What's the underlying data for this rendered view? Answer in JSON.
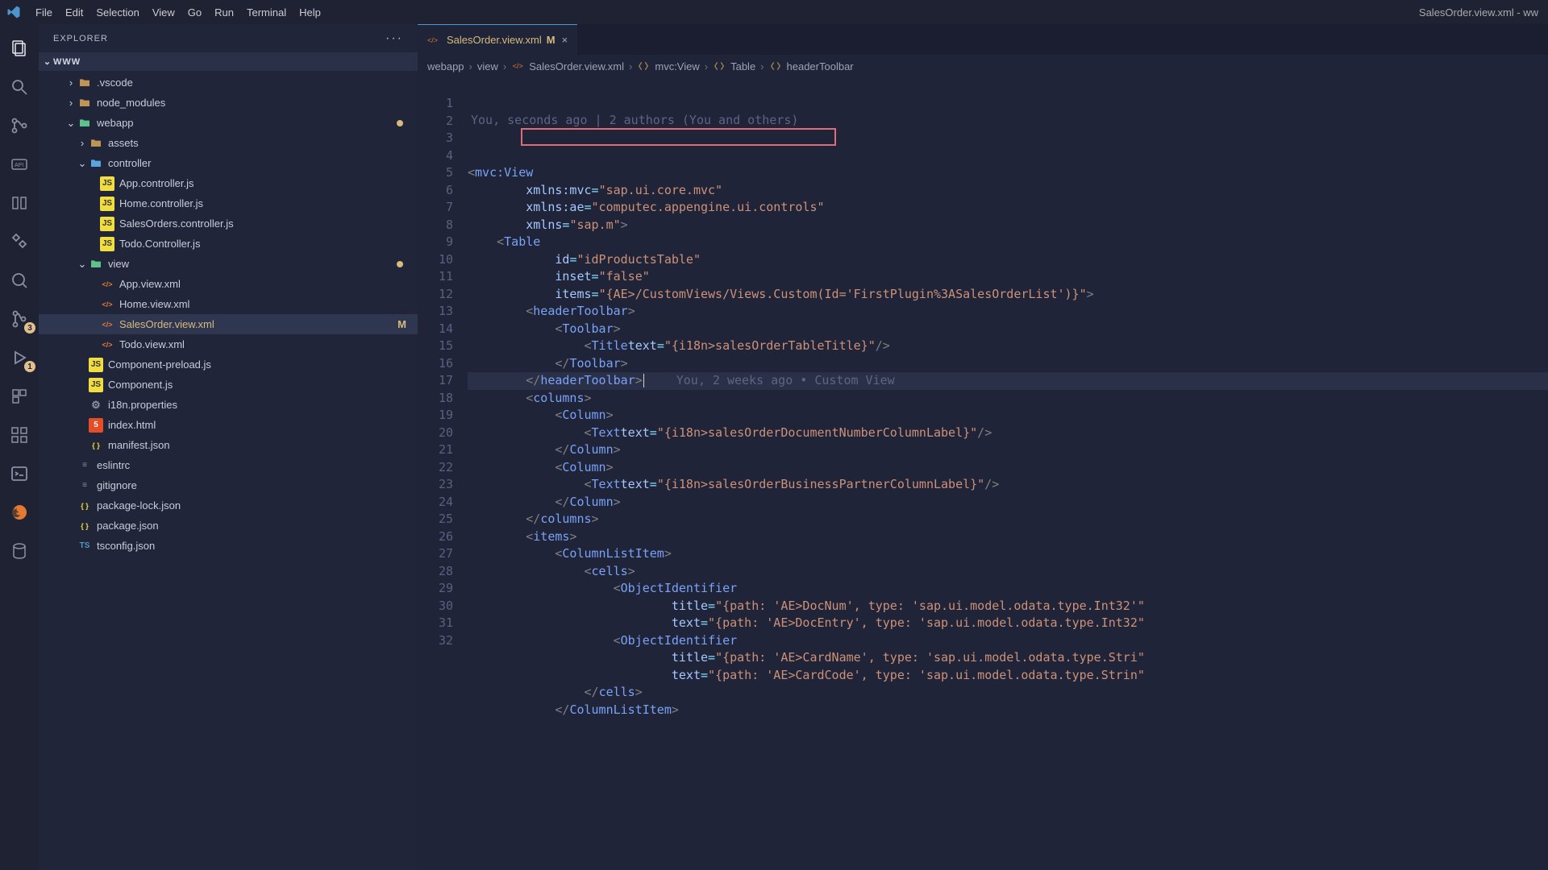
{
  "window": {
    "title_right": "SalesOrder.view.xml - ww"
  },
  "menu": {
    "items": [
      "File",
      "Edit",
      "Selection",
      "View",
      "Go",
      "Run",
      "Terminal",
      "Help"
    ]
  },
  "activity": {
    "scm_badge": "3",
    "debug_badge": "1"
  },
  "sidebar": {
    "title": "EXPLORER",
    "root": "WWW",
    "tree": [
      {
        "depth": 1,
        "twisty": "›",
        "icon": "folder",
        "label": ".vscode"
      },
      {
        "depth": 1,
        "twisty": "›",
        "icon": "folder",
        "label": "node_modules"
      },
      {
        "depth": 1,
        "twisty": "⌄",
        "icon": "folder-green",
        "label": "webapp",
        "dot": true
      },
      {
        "depth": 2,
        "twisty": "›",
        "icon": "folder",
        "label": "assets"
      },
      {
        "depth": 2,
        "twisty": "⌄",
        "icon": "folder-blue",
        "label": "controller"
      },
      {
        "depth": 3,
        "twisty": "",
        "icon": "js",
        "label": "App.controller.js"
      },
      {
        "depth": 3,
        "twisty": "",
        "icon": "js",
        "label": "Home.controller.js"
      },
      {
        "depth": 3,
        "twisty": "",
        "icon": "js",
        "label": "SalesOrders.controller.js"
      },
      {
        "depth": 3,
        "twisty": "",
        "icon": "js",
        "label": "Todo.Controller.js"
      },
      {
        "depth": 2,
        "twisty": "⌄",
        "icon": "folder-green",
        "label": "view",
        "dot": true
      },
      {
        "depth": 3,
        "twisty": "",
        "icon": "xml",
        "label": "App.view.xml"
      },
      {
        "depth": 3,
        "twisty": "",
        "icon": "xml",
        "label": "Home.view.xml"
      },
      {
        "depth": 3,
        "twisty": "",
        "icon": "xml",
        "label": "SalesOrder.view.xml",
        "selected": true,
        "mod": "M"
      },
      {
        "depth": 3,
        "twisty": "",
        "icon": "xml",
        "label": "Todo.view.xml"
      },
      {
        "depth": 2,
        "twisty": "",
        "icon": "js",
        "label": "Component-preload.js"
      },
      {
        "depth": 2,
        "twisty": "",
        "icon": "js",
        "label": "Component.js"
      },
      {
        "depth": 2,
        "twisty": "",
        "icon": "props",
        "label": "i18n.properties"
      },
      {
        "depth": 2,
        "twisty": "",
        "icon": "html",
        "label": "index.html"
      },
      {
        "depth": 2,
        "twisty": "",
        "icon": "json",
        "label": "manifest.json"
      },
      {
        "depth": 1,
        "twisty": "",
        "icon": "generic",
        "label": "eslintrc"
      },
      {
        "depth": 1,
        "twisty": "",
        "icon": "generic",
        "label": "gitignore"
      },
      {
        "depth": 1,
        "twisty": "",
        "icon": "json",
        "label": "package-lock.json"
      },
      {
        "depth": 1,
        "twisty": "",
        "icon": "json",
        "label": "package.json"
      },
      {
        "depth": 1,
        "twisty": "",
        "icon": "ts",
        "label": "tsconfig.json"
      }
    ]
  },
  "tabs": [
    {
      "icon": "xml",
      "label": "SalesOrder.view.xml",
      "mod": "M",
      "active": true
    }
  ],
  "breadcrumbs": [
    {
      "label": "webapp",
      "icon": ""
    },
    {
      "label": "view",
      "icon": ""
    },
    {
      "label": "SalesOrder.view.xml",
      "icon": "xml"
    },
    {
      "label": "mvc:View",
      "icon": "sym"
    },
    {
      "label": "Table",
      "icon": "sym"
    },
    {
      "label": "headerToolbar",
      "icon": "sym"
    }
  ],
  "editor": {
    "blame_top": "You, seconds ago | 2 authors (You and others)",
    "inline_blame_13": "You, 2 weeks ago • Custom View",
    "chart_data": null,
    "lines": [
      {
        "n": 1,
        "ind": 0,
        "raw": "<mvc:View"
      },
      {
        "n": 2,
        "ind": 2,
        "raw": "xmlns:mvc=\"sap.ui.core.mvc\""
      },
      {
        "n": 3,
        "ind": 2,
        "raw": "xmlns:ae=\"computec.appengine.ui.controls\"",
        "boxed": true
      },
      {
        "n": 4,
        "ind": 2,
        "raw": "xmlns=\"sap.m\">"
      },
      {
        "n": 5,
        "ind": 1,
        "raw": "<Table"
      },
      {
        "n": 6,
        "ind": 3,
        "raw": "id=\"idProductsTable\""
      },
      {
        "n": 7,
        "ind": 3,
        "raw": "inset=\"false\""
      },
      {
        "n": 8,
        "ind": 3,
        "raw": "items=\"{AE>/CustomViews/Views.Custom(Id='FirstPlugin%3ASalesOrderList')}\">"
      },
      {
        "n": 9,
        "ind": 2,
        "raw": "<headerToolbar>"
      },
      {
        "n": 10,
        "ind": 3,
        "raw": "<Toolbar>"
      },
      {
        "n": 11,
        "ind": 4,
        "raw": "<Title text=\"{i18n>salesOrderTableTitle}\"/>"
      },
      {
        "n": 12,
        "ind": 3,
        "raw": "</Toolbar>"
      },
      {
        "n": 13,
        "ind": 2,
        "raw": "</headerToolbar>",
        "current": true,
        "blame": true
      },
      {
        "n": 14,
        "ind": 2,
        "raw": "<columns>"
      },
      {
        "n": 15,
        "ind": 3,
        "raw": "<Column>"
      },
      {
        "n": 16,
        "ind": 4,
        "raw": "<Text text=\"{i18n>salesOrderDocumentNumberColumnLabel}\"/>"
      },
      {
        "n": 17,
        "ind": 3,
        "raw": "</Column>"
      },
      {
        "n": 18,
        "ind": 3,
        "raw": "<Column>"
      },
      {
        "n": 19,
        "ind": 4,
        "raw": "<Text text=\"{i18n>salesOrderBusinessPartnerColumnLabel}\"/>"
      },
      {
        "n": 20,
        "ind": 3,
        "raw": "</Column>"
      },
      {
        "n": 21,
        "ind": 2,
        "raw": "</columns>"
      },
      {
        "n": 22,
        "ind": 2,
        "raw": "<items>"
      },
      {
        "n": 23,
        "ind": 3,
        "raw": "<ColumnListItem>"
      },
      {
        "n": 24,
        "ind": 4,
        "raw": "<cells>"
      },
      {
        "n": 25,
        "ind": 5,
        "raw": "<ObjectIdentifier"
      },
      {
        "n": 26,
        "ind": 7,
        "raw": "title=\"{path: 'AE>DocNum', type: 'sap.ui.model.odata.type.Int32'"
      },
      {
        "n": 27,
        "ind": 7,
        "raw": "text=\"{path: 'AE>DocEntry', type: 'sap.ui.model.odata.type.Int32"
      },
      {
        "n": 28,
        "ind": 5,
        "raw": "<ObjectIdentifier"
      },
      {
        "n": 29,
        "ind": 7,
        "raw": "title=\"{path: 'AE>CardName', type: 'sap.ui.model.odata.type.Stri"
      },
      {
        "n": 30,
        "ind": 7,
        "raw": "text=\"{path: 'AE>CardCode', type: 'sap.ui.model.odata.type.Strin"
      },
      {
        "n": 31,
        "ind": 4,
        "raw": "</cells>"
      },
      {
        "n": 32,
        "ind": 3,
        "raw": "</ColumnListItem>"
      }
    ]
  }
}
